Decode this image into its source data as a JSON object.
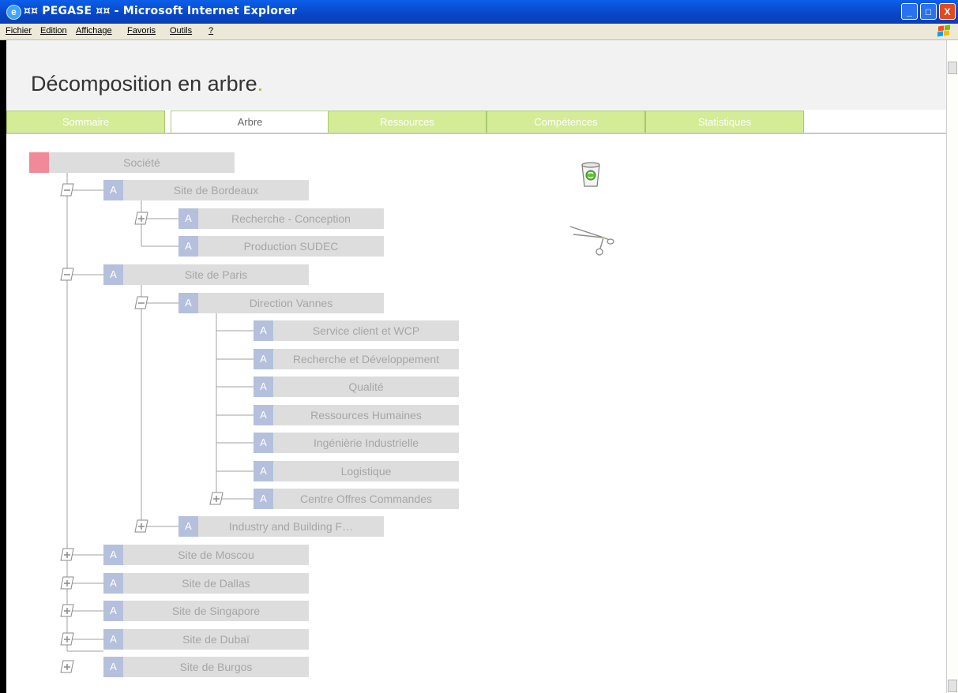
{
  "window": {
    "title": "¤¤ PEGASE ¤¤ - Microsoft Internet Explorer",
    "controls": {
      "minimize": "_",
      "maximize": "□",
      "close": "X"
    }
  },
  "menu": [
    "Fichier",
    "Edition",
    "Affichage",
    "Favoris",
    "Outils",
    "?"
  ],
  "page": {
    "title_main": "Décomposition en arbre",
    "title_dot": ".",
    "accent_color": "#96c23a"
  },
  "tabs": [
    {
      "label": "Sommaire",
      "active": false
    },
    {
      "label": "Arbre",
      "active": true
    },
    {
      "label": "Ressources",
      "active": false
    },
    {
      "label": "Compétences",
      "active": false
    },
    {
      "label": "Statistiques",
      "active": false
    }
  ],
  "tree": {
    "root": "Société",
    "node_badge": "A",
    "nodes": [
      {
        "label": "Site de Bordeaux",
        "toggle": "collapse"
      },
      {
        "label": "Recherche - Conception",
        "toggle": "expand"
      },
      {
        "label": "Production SUDEC",
        "toggle": "none"
      },
      {
        "label": "Site de Paris",
        "toggle": "collapse"
      },
      {
        "label": "Direction Vannes",
        "toggle": "collapse"
      },
      {
        "label": "Service client et WCP",
        "toggle": "none"
      },
      {
        "label": "Recherche et Développement",
        "toggle": "none"
      },
      {
        "label": "Qualité",
        "toggle": "none"
      },
      {
        "label": "Ressources Humaines",
        "toggle": "none"
      },
      {
        "label": "Ingénièrie Industrielle",
        "toggle": "none"
      },
      {
        "label": "Logistique",
        "toggle": "none"
      },
      {
        "label": "Centre Offres Commandes",
        "toggle": "expand"
      },
      {
        "label": "Industry and Building F…",
        "toggle": "expand"
      },
      {
        "label": "Site de Moscou",
        "toggle": "expand"
      },
      {
        "label": "Site de Dallas",
        "toggle": "expand"
      },
      {
        "label": "Site de Singapore",
        "toggle": "expand"
      },
      {
        "label": "Site de Dubaï",
        "toggle": "expand"
      },
      {
        "label": "Site de Burgos",
        "toggle": "expand"
      }
    ]
  },
  "tools": [
    "recycle-bin-icon",
    "scissors-icon"
  ]
}
